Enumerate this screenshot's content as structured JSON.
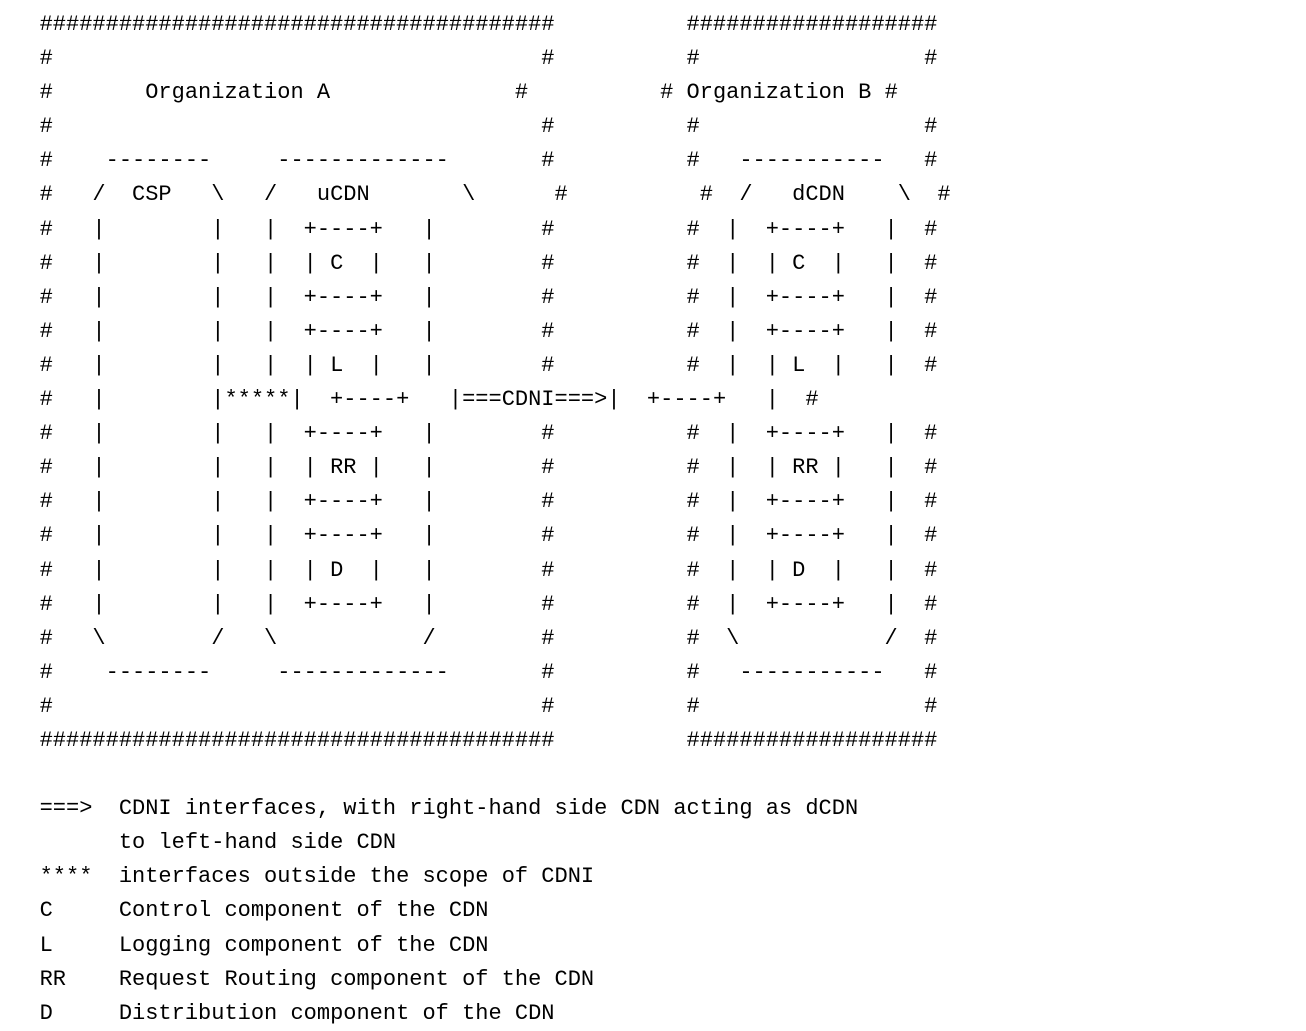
{
  "orgA": {
    "title": "Organization A"
  },
  "orgB": {
    "title": "Organization B"
  },
  "csp": {
    "label": "CSP"
  },
  "ucdn": {
    "label": "uCDN",
    "components": {
      "C": "C",
      "L": "L",
      "RR": "RR",
      "D": "D"
    }
  },
  "dcdn": {
    "label": "dCDN",
    "components": {
      "C": "C",
      "L": "L",
      "RR": "RR",
      "D": "D"
    }
  },
  "connector_cdni": "===CDNI===>",
  "connector_outside": "*****",
  "legend": {
    "arrow_sym": "===>",
    "arrow_text_1": "CDNI interfaces, with right-hand side CDN acting as dCDN",
    "arrow_text_2": "to left-hand side CDN",
    "stars_sym": "****",
    "stars_text": "interfaces outside the scope of CDNI",
    "C_sym": "C",
    "C_text": "Control component of the CDN",
    "L_sym": "L",
    "L_text": "Logging component of the CDN",
    "RR_sym": "RR",
    "RR_text": "Request Routing component of the CDN",
    "D_sym": "D",
    "D_text": "Distribution component of the CDN"
  },
  "ascii": {
    "l01": "   #######################################          ###################",
    "l02": "   #                                     #          #                 #",
    "l03b": "   #       ",
    "l03m": "              #          # ",
    "l03e": " #",
    "l04": "   #                                     #          #                 #",
    "l05": "   #    --------     -------------       #          #   -----------   #",
    "l06a": "   #   /  ",
    "l06b": "   \\   /   ",
    "l06c": "       \\      #          #  /   ",
    "l06d": "    \\  #",
    "l07": "   #   |        |   |  +----+   |        #          #  |  +----+   |  #",
    "l08a": "   #   |        |   |  | ",
    "l08b": "  |   |        #          #  |  | ",
    "l08c": "  |   |  #",
    "l09": "   #   |        |   |  +----+   |        #          #  |  +----+   |  #",
    "l10": "   #   |        |   |  +----+   |        #          #  |  +----+   |  #",
    "l11a": "   #   |        |   |  | ",
    "l11b": "  |   |        #          #  |  | ",
    "l11c": "  |   |  #",
    "l12a": "   #   |        |",
    "l12b": "|  +----+   |",
    "l12c": "|  +----+   |  #",
    "l13": "   #   |        |   |  +----+   |        #          #  |  +----+   |  #",
    "l14a": "   #   |        |   |  | ",
    "l14b": " |   |        #          #  |  | ",
    "l14c": " |   |  #",
    "l15": "   #   |        |   |  +----+   |        #          #  |  +----+   |  #",
    "l16": "   #   |        |   |  +----+   |        #          #  |  +----+   |  #",
    "l17a": "   #   |        |   |  | ",
    "l17b": "  |   |        #          #  |  | ",
    "l17c": "  |   |  #",
    "l18": "   #   |        |   |  +----+   |        #          #  |  +----+   |  #",
    "l19": "   #   \\        /   \\           /        #          #  \\           /  #",
    "l20": "   #    --------     -------------       #          #   -----------   #",
    "l21": "   #                                     #          #                 #",
    "l22": "   #######################################          ###################"
  }
}
